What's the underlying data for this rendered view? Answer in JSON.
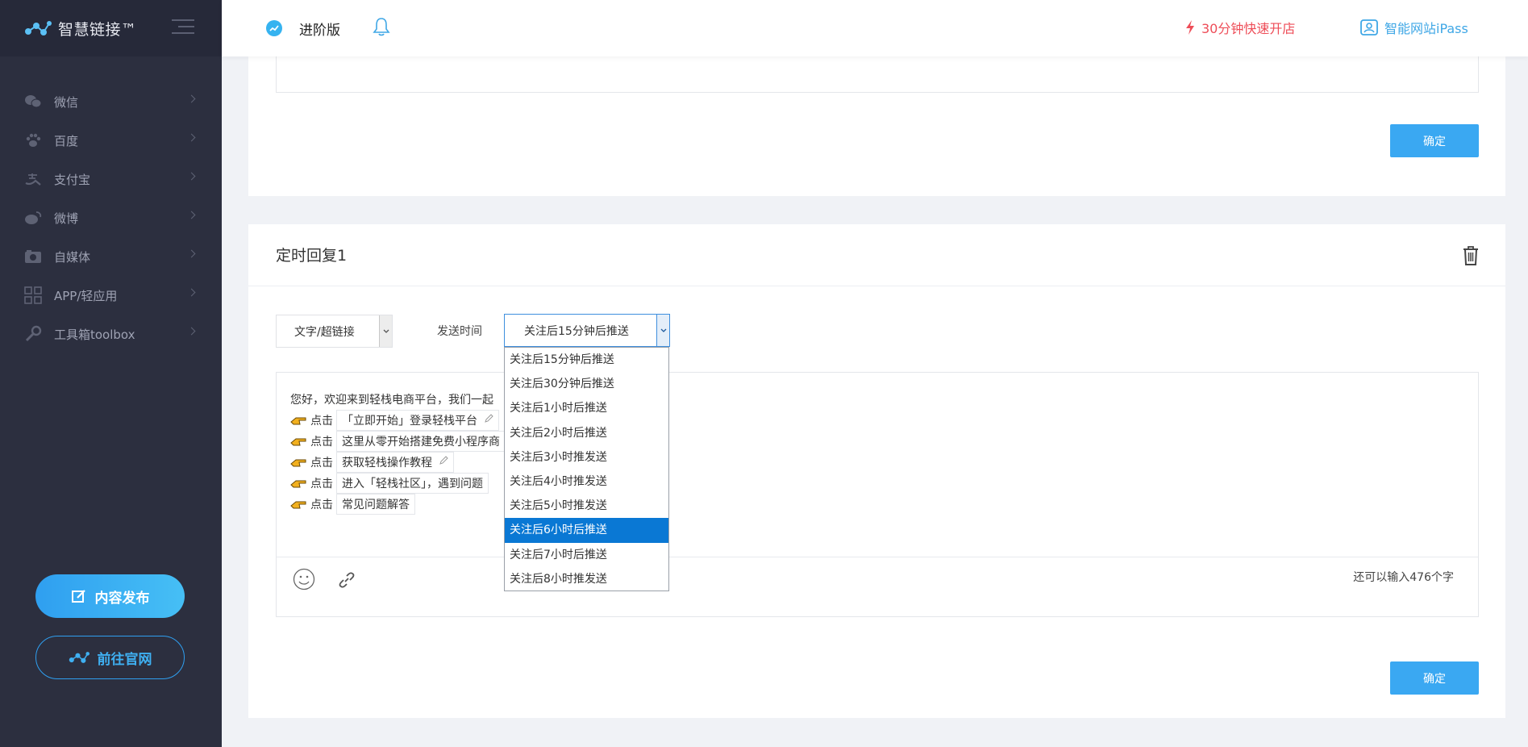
{
  "sidebar": {
    "logo_text": "智慧链接™",
    "items": [
      {
        "label": "微信",
        "icon": "wechat-icon"
      },
      {
        "label": "百度",
        "icon": "paw-icon"
      },
      {
        "label": "支付宝",
        "icon": "alipay-icon"
      },
      {
        "label": "微博",
        "icon": "weibo-icon"
      },
      {
        "label": "自媒体",
        "icon": "camera-icon"
      },
      {
        "label": "APP/轻应用",
        "icon": "app-grid-icon"
      },
      {
        "label": "工具箱toolbox",
        "icon": "wrench-icon"
      }
    ],
    "publish_label": "内容发布",
    "official_label": "前往官网"
  },
  "topbar": {
    "edition_label": "进阶版",
    "quick_open_label": "30分钟快速开店",
    "ipass_label": "智能网站iPass"
  },
  "card1": {
    "confirm_label": "确定"
  },
  "card2": {
    "title": "定时回复1",
    "type_select_value": "文字/超链接",
    "send_time_label": "发送时间",
    "send_time_value": "关注后15分钟后推送",
    "message_intro": "您好，欢迎来到轻栈电商平台，我们一起",
    "message_lines": [
      {
        "prefix": "点击",
        "chip": "「立即开始」登录轻栈平台",
        "pen": true
      },
      {
        "prefix": "点击",
        "chip": "这里从零开始搭建免费小程序商",
        "pen": false
      },
      {
        "prefix": "点击",
        "chip": "获取轻栈操作教程",
        "pen": true
      },
      {
        "prefix": "点击",
        "chip": "进入「轻栈社区」，遇到问题",
        "pen": false
      },
      {
        "prefix": "点击",
        "chip": "常见问题解答",
        "pen": false
      }
    ],
    "remaining_text": "还可以输入476个字",
    "confirm_label": "确定"
  },
  "dropdown": {
    "options": [
      "关注后15分钟后推送",
      "关注后30分钟后推送",
      "关注后1小时后推送",
      "关注后2小时后推送",
      "关注后3小时推发送",
      "关注后4小时推发送",
      "关注后5小时推发送",
      "关注后6小时后推送",
      "关注后7小时后推送",
      "关注后8小时推发送"
    ],
    "selected_index": 7
  },
  "colors": {
    "sidebar_bg": "#2c2f3f",
    "accent": "#3aa8f2",
    "danger": "#ee4d58",
    "selected": "#0a78d4"
  }
}
